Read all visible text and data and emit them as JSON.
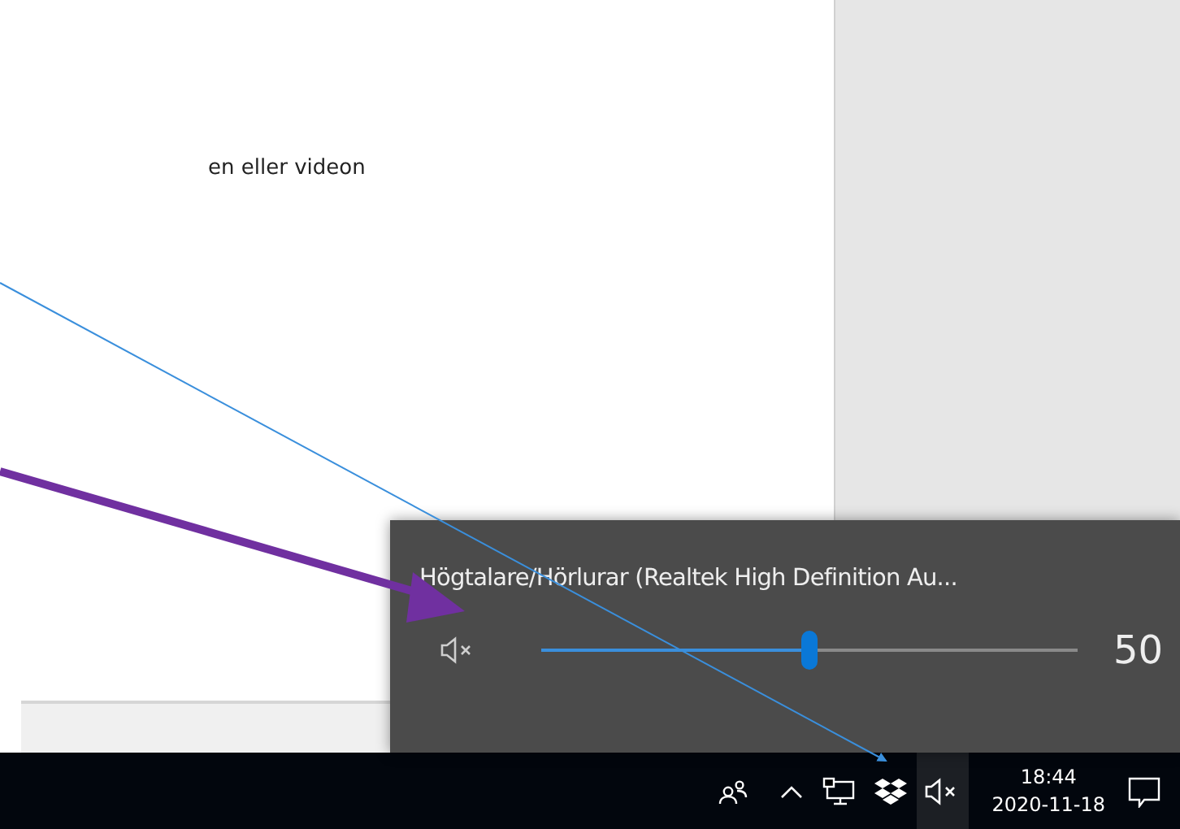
{
  "document": {
    "text": "en eller videon"
  },
  "volume_flyout": {
    "device_title": "Högtalare/Hörlurar (Realtek High Definition Au...",
    "muted": true,
    "level": 0.5,
    "reading": "50"
  },
  "taskbar": {
    "volume_muted": true,
    "time": "18:44",
    "date": "2020-11-18"
  }
}
